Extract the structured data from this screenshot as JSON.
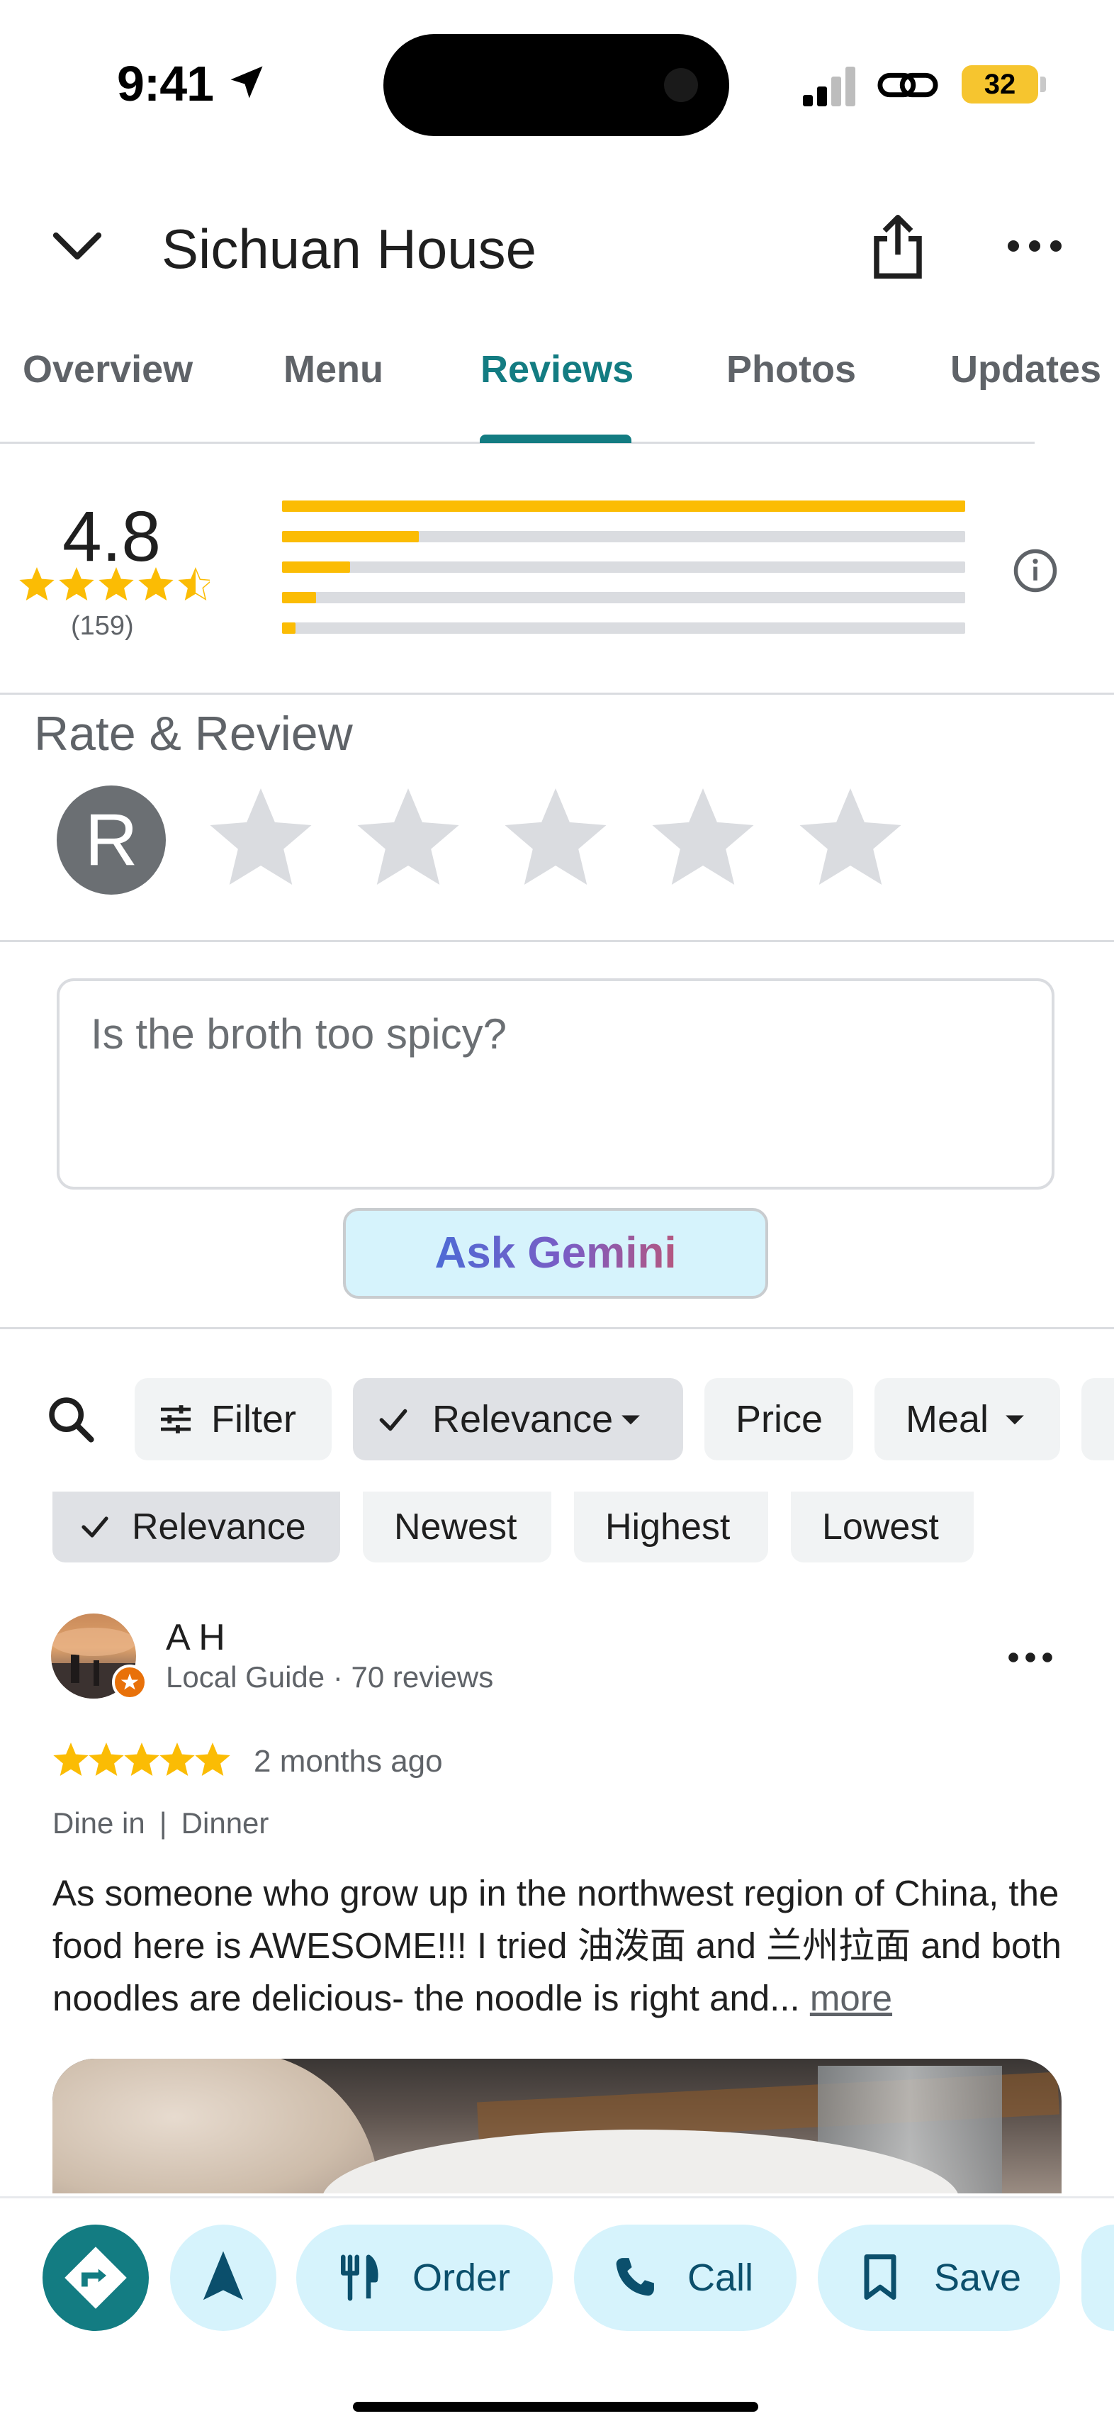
{
  "status_bar": {
    "time": "9:41",
    "battery": "32"
  },
  "header": {
    "title": "Sichuan House"
  },
  "tabs": [
    {
      "label": "Overview"
    },
    {
      "label": "Menu"
    },
    {
      "label": "Reviews"
    },
    {
      "label": "Photos"
    },
    {
      "label": "Updates"
    }
  ],
  "active_tab": "Reviews",
  "rating": {
    "average": "4.8",
    "count": "(159)",
    "star_value": 4.5,
    "distribution": [
      {
        "stars": 5,
        "fraction": 1.0
      },
      {
        "stars": 4,
        "fraction": 0.2
      },
      {
        "stars": 3,
        "fraction": 0.1
      },
      {
        "stars": 2,
        "fraction": 0.05
      },
      {
        "stars": 1,
        "fraction": 0.02
      }
    ]
  },
  "rate_review": {
    "title": "Rate & Review",
    "avatar_initial": "R",
    "star_count": 5
  },
  "ask": {
    "placeholder": "Is the broth too spicy?",
    "button": "Ask Gemini"
  },
  "filters": {
    "chips": [
      {
        "label": "Filter"
      },
      {
        "label": "Relevance",
        "selected": true
      },
      {
        "label": "Price"
      },
      {
        "label": "Meal"
      }
    ],
    "sort_options": [
      {
        "label": "Relevance",
        "selected": true
      },
      {
        "label": "Newest"
      },
      {
        "label": "Highest"
      },
      {
        "label": "Lowest"
      }
    ]
  },
  "review": {
    "name": "A H",
    "meta": "Local Guide · 70 reviews",
    "stars": 5,
    "time": "2 months ago",
    "tags": [
      "Dine in",
      "Dinner"
    ],
    "text": "As someone who grow up in the northwest region of China, the food here is AWESOME!!! I tried 油泼面 and 兰州拉面 and both noodles are delicious- the noodle is right and...",
    "more_label": "more"
  },
  "bottom_actions": [
    {
      "label": "Order",
      "icon": "fork-knife-icon"
    },
    {
      "label": "Call",
      "icon": "phone-icon"
    },
    {
      "label": "Save",
      "icon": "bookmark-icon"
    }
  ],
  "colors": {
    "accent": "#137c82",
    "star": "#fbbc04",
    "pill_bg": "#d6f3fc"
  }
}
